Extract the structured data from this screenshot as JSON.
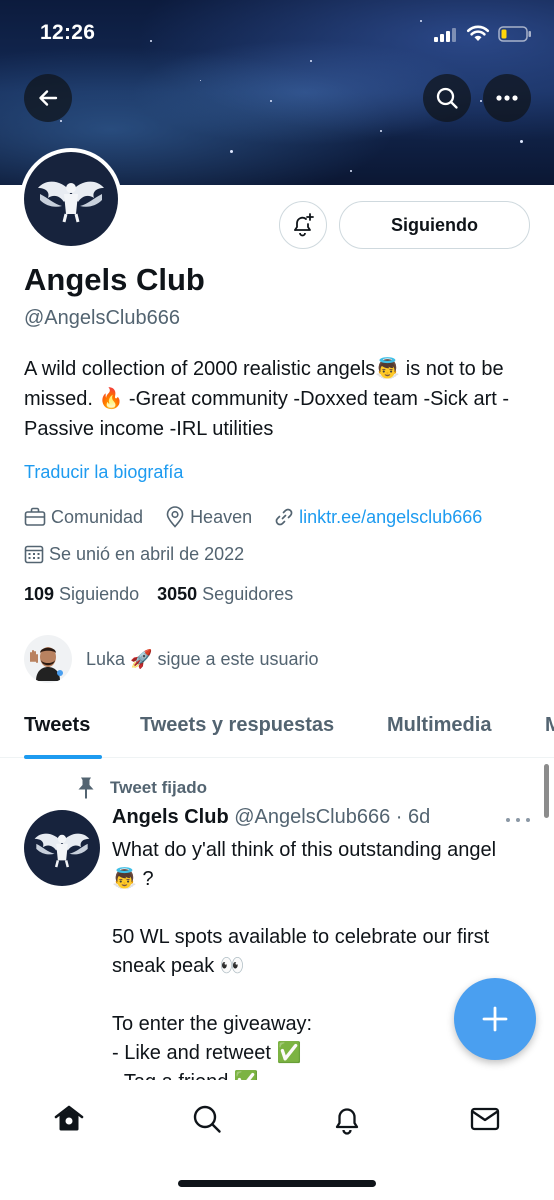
{
  "status_bar": {
    "time": "12:26"
  },
  "profile": {
    "display_name": "Angels Club",
    "handle": "@AngelsClub666",
    "bio": "A wild collection of 2000 realistic angels👼 is not to be missed. 🔥 -Great community -Doxxed team -Sick art -Passive income -IRL utilities",
    "translate_label": "Traducir la biografía",
    "category": "Comunidad",
    "location": "Heaven",
    "website": "linktr.ee/angelsclub666",
    "joined": "Se unió en abril de 2022",
    "following_count": "109",
    "following_label": "Siguiendo",
    "followers_count": "3050",
    "followers_label": "Seguidores",
    "followed_by_text": "Luka 🚀 sigue a este usuario",
    "follow_button_label": "Siguiendo"
  },
  "tabs": [
    {
      "label": "Tweets",
      "active": true
    },
    {
      "label": "Tweets y respuestas",
      "active": false
    },
    {
      "label": "Multimedia",
      "active": false
    },
    {
      "label": "M",
      "active": false
    }
  ],
  "tweet": {
    "pinned_label": "Tweet fijado",
    "author_name": "Angels Club",
    "author_handle": "@AngelsClub666",
    "time_ago": "6d",
    "separator": " · ",
    "text": "What do y'all think of this outstanding angel 👼 ?\n\n50 WL spots available to celebrate our first sneak peak 👀\n\nTo enter the giveaway:\n- Like and retweet ✅\n- Tag a friend ✅"
  },
  "colors": {
    "accent": "#1d9bf0",
    "fab": "#4a9ff0",
    "text_primary": "#0f1419",
    "text_secondary": "#536471"
  },
  "icons": {
    "back": "arrow-left-icon",
    "search": "search-icon",
    "more": "more-horizontal-icon",
    "bell": "bell-plus-icon",
    "category": "briefcase-icon",
    "location": "location-pin-icon",
    "link": "link-icon",
    "calendar": "calendar-icon",
    "pin": "pin-icon",
    "compose": "plus-icon",
    "nav": [
      "home-icon",
      "search-icon",
      "bell-icon",
      "mail-icon"
    ]
  }
}
